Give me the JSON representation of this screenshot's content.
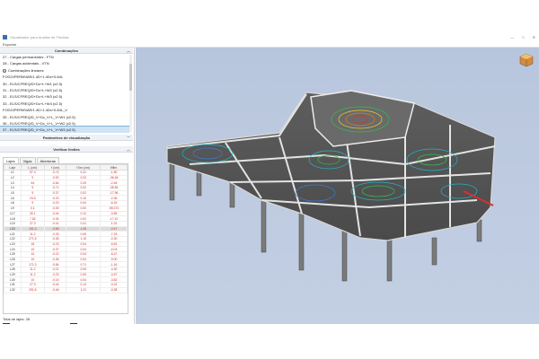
{
  "window": {
    "title": "Visualizador para Análise de Flechas",
    "controls": [
      "—",
      "□",
      "✕"
    ]
  },
  "menu": {
    "item": "Exportar"
  },
  "sections": {
    "combinacoes": "Combinações",
    "parametros": "Parâmetros de visualização",
    "verificar": "Verificar limites"
  },
  "combos": [
    {
      "label": "27 - Cargas permanentes - FTN"
    },
    {
      "label": "28 - Cargas acidentais - VTN"
    },
    {
      "label": "Combinações lineares",
      "expander": "−"
    },
    {
      "label": "FOGO/PERMVAR/1.4D+1.4Dc+0.84L"
    },
    {
      "label": "30 - ELS/CFREQ/D+Dc+L+W1 (x2.5)"
    },
    {
      "label": "31 - ELS/CFREQ/D+Dc+L+W2 (x2.5)"
    },
    {
      "label": "32 - ELS/CFREQ/D+Dc+L+W3 (x2.5)"
    },
    {
      "label": "33 - ELS/CFREQ/D+Dc+L+W4 (x2.5)"
    },
    {
      "label": "FOGO/PERMVAR/1.4D+1.4Dc+0.84L_V"
    },
    {
      "label": "35 - ELS/CFREQ/D_V+Dc_V+L_V+W1 (x2.5)"
    },
    {
      "label": "36 - ELS/CFREQ/D_V+Dc_V+L_V+W2 (x2.5)"
    },
    {
      "label": "37 - ELS/CFREQ/D_V+Dc_V+L_V+W3 (x2.5)",
      "selected": true
    },
    {
      "label": "38 - ELS/CFREQ/D_V+Dc_V+L_V+W4 (x2.5)"
    }
  ],
  "tabs": [
    "Lajes",
    "Vigas",
    "Aberturas"
  ],
  "grid": {
    "headers": [
      "Laje",
      "L (cm)",
      "f (cm)",
      "f lim (cm)",
      "f/flim"
    ],
    "rows": [
      [
        "L1",
        "97.3",
        "-0.74",
        "0.41",
        "-1.80"
      ],
      [
        "L2",
        "9",
        "-0.92",
        "0.03",
        "-36.48"
      ],
      [
        "L3",
        "64",
        "-0.64",
        "0.26",
        "-2.46"
      ],
      [
        "L4",
        "5",
        "-0.71",
        "0.02",
        "-35.56"
      ],
      [
        "L5",
        "5",
        "-0.37",
        "0.02",
        "-17.96"
      ],
      [
        "L6",
        "23.9",
        "-0.23",
        "0.10",
        "-2.36"
      ],
      [
        "L8",
        "9",
        "-0.23",
        "0.04",
        "-6.16"
      ],
      [
        "L9",
        "0.1",
        "-0.00",
        "0.00",
        "-98.074"
      ],
      [
        "L17",
        "30.1",
        "-0.44",
        "0.12",
        "-3.65"
      ],
      [
        "L18",
        "7.82",
        "-0.34",
        "0.02",
        "-17.10"
      ],
      [
        "L19",
        "27.3",
        "-0.41",
        "0.41",
        "-1.01"
      ],
      [
        "L20",
        "101.3",
        "-0.68",
        "1.08",
        "-0.47",
        "sel"
      ],
      [
        "L21",
        "11.2",
        "-0.33",
        "0.05",
        "-7.33"
      ],
      [
        "L22",
        "271.5",
        "-0.35",
        "1.15",
        "-0.30"
      ],
      [
        "L23",
        "18",
        "-0.23",
        "0.04",
        "-5.62"
      ],
      [
        "L24",
        "10",
        "-0.37",
        "0.04",
        "-10.8"
      ],
      [
        "L25",
        "10",
        "-0.22",
        "0.04",
        "-6.47"
      ],
      [
        "L26",
        "10",
        "-0.36",
        "0.04",
        "-9.00"
      ],
      [
        "L27",
        "171.3",
        "-0.84",
        "0.71",
        "-1.16"
      ],
      [
        "L28",
        "11.2",
        "-0.21",
        "0.05",
        "-4.30"
      ],
      [
        "L29",
        "11.2",
        "-0.23",
        "0.05",
        "-4.57"
      ],
      [
        "L30",
        "10",
        "-0.15",
        "0.04",
        "-3.82"
      ],
      [
        "L31",
        "27.3",
        "-0.44",
        "0.14",
        "-3.22"
      ],
      [
        "L32",
        "291.8",
        "-0.46",
        "1.21",
        "-0.38"
      ]
    ]
  },
  "footer": {
    "count": "Total de lajes: 28",
    "btn_left": "Definir vão por 1 ponto",
    "btn_right": "Redefinir todos os vãos"
  },
  "colors": {
    "viewport_top": "#b8c6dd",
    "selected_row": "#cfe3f5",
    "value_red": "#cc3333"
  }
}
